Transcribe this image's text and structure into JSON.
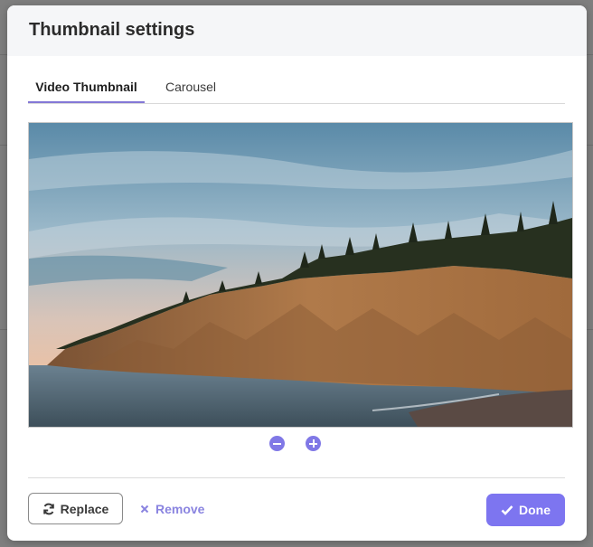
{
  "modal": {
    "title": "Thumbnail settings"
  },
  "tabs": [
    {
      "label": "Video Thumbnail",
      "active": true
    },
    {
      "label": "Carousel",
      "active": false
    }
  ],
  "preview": {
    "image": "coastal-cliff-landscape"
  },
  "zoom": {
    "out_icon": "minus-circle-icon",
    "in_icon": "plus-circle-icon"
  },
  "footer": {
    "replace_label": "Replace",
    "remove_label": "Remove",
    "done_label": "Done"
  },
  "colors": {
    "accent": "#7d75f0",
    "tab_underline": "#8478d6",
    "remove_text": "#8a84e0"
  }
}
